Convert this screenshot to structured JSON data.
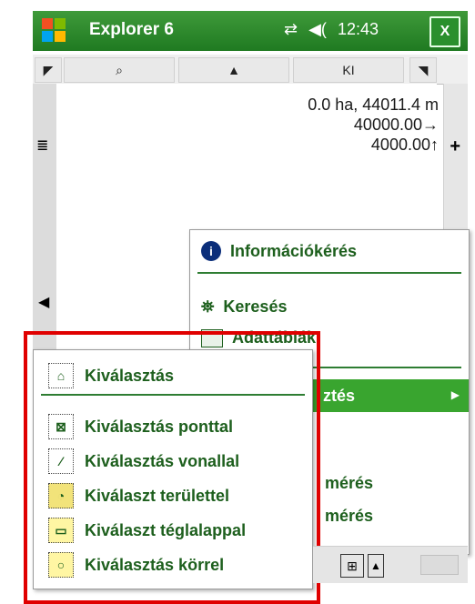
{
  "app": {
    "title": "Explorer 6",
    "status_connectivity": "⇄",
    "status_volume": "◀(",
    "time": "12:43",
    "close_label": "X"
  },
  "toolbar": {
    "left_arrow": "◤",
    "zoom_icon": "⌕",
    "up_arrow": "▲",
    "fit_icon": "KI",
    "right_arrow": "◥"
  },
  "map_info": {
    "line1": "0.0 ha, 44011.4 m",
    "line2": "40000.00→",
    "line3": "4000.00↑",
    "plus": "+"
  },
  "menu": {
    "items": [
      {
        "label": "Információkérés",
        "icon": "info-icon"
      },
      {
        "label": "Keresés",
        "icon": "binoculars-icon"
      },
      {
        "label": "Adattáblák",
        "icon": "table-icon"
      },
      {
        "label": "ztés",
        "icon": "none"
      },
      {
        "label": "mérés",
        "icon": "none"
      },
      {
        "label": "mérés",
        "icon": "none"
      }
    ]
  },
  "submenu": {
    "items": [
      {
        "label": "Kiválasztás",
        "icon": "select-icon"
      },
      {
        "label": "Kiválasztás ponttal",
        "icon": "point-select-icon"
      },
      {
        "label": "Kiválasztás vonallal",
        "icon": "line-select-icon"
      },
      {
        "label": "Kiválaszt területtel",
        "icon": "area-select-icon"
      },
      {
        "label": "Kiválaszt téglalappal",
        "icon": "rectangle-select-icon"
      },
      {
        "label": "Kiválasztás körrel",
        "icon": "circle-select-icon"
      }
    ]
  }
}
